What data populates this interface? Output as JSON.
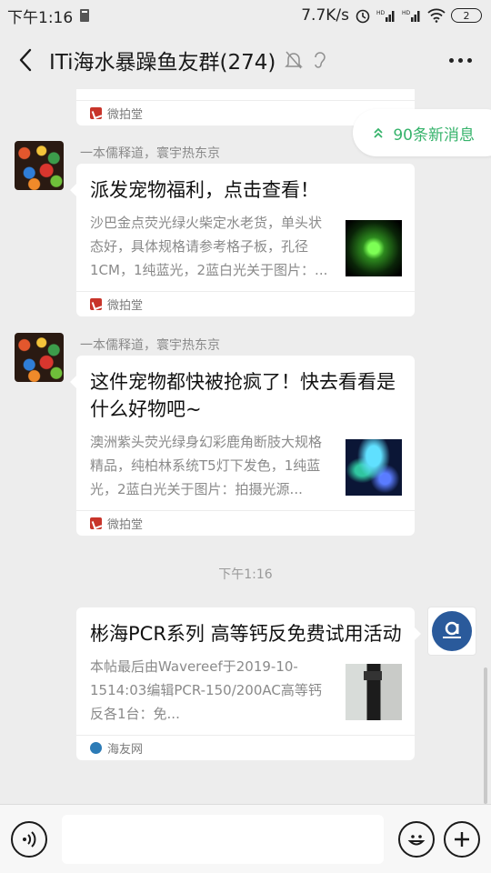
{
  "status_bar": {
    "time": "下午1:16",
    "net_speed": "7.7K/s",
    "battery": "2"
  },
  "header": {
    "title": "ITi海水暴躁鱼友群(274)"
  },
  "new_messages": {
    "label": "90条新消息"
  },
  "messages": [
    {
      "source": "微拍堂"
    },
    {
      "sender": "一本儒释道，寰宇热东京",
      "title": "派发宠物福利，点击查看！",
      "desc": "沙巴金点荧光绿火柴定水老货，单头状态好，具体规格请参考格子板，孔径1CM，1纯蓝光，2蓝白光关于图片：...",
      "source": "微拍堂"
    },
    {
      "sender": "一本儒释道，寰宇热东京",
      "title": "这件宠物都快被抢疯了！快去看看是什么好物吧~",
      "desc": "澳洲紫头荧光绿身幻彩鹿角断肢大规格精品，纯柏林系统T5灯下发色，1纯蓝光，2蓝白光关于图片：拍摄光源...",
      "source": "微拍堂"
    },
    {
      "time": "下午1:16"
    },
    {
      "title": "彬海PCR系列 高等钙反免费试用活动",
      "desc": "本帖最后由Wavereef于2019-10-1514:03编辑PCR-150/200AC高等钙反各1台：免...",
      "source": "海友网"
    }
  ],
  "input": {
    "placeholder": ""
  }
}
